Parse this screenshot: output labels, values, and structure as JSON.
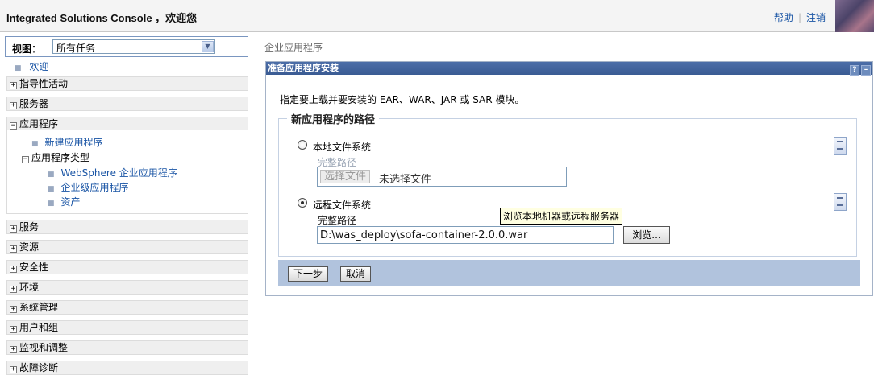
{
  "header": {
    "title": "Integrated Solutions Console ，欢迎您",
    "help": "帮助",
    "separator": "|",
    "logout": "注销"
  },
  "nav": {
    "view_label": "视图：",
    "view_value": "所有任务",
    "welcome": "欢迎",
    "items": [
      {
        "label": "指导性活动",
        "state": "+"
      },
      {
        "label": "服务器",
        "state": "+"
      },
      {
        "label": "应用程序",
        "state": "−"
      },
      {
        "label": "服务",
        "state": "+"
      },
      {
        "label": "资源",
        "state": "+"
      },
      {
        "label": "安全性",
        "state": "+"
      },
      {
        "label": "环境",
        "state": "+"
      },
      {
        "label": "系统管理",
        "state": "+"
      },
      {
        "label": "用户和组",
        "state": "+"
      },
      {
        "label": "监视和调整",
        "state": "+"
      },
      {
        "label": "故障诊断",
        "state": "+"
      }
    ],
    "app_children": {
      "new_app": "新建应用程序",
      "app_types": "应用程序类型",
      "app_types_state": "−",
      "websphere": "WebSphere 企业应用程序",
      "enterprise": "企业级应用程序",
      "assets": "资产"
    }
  },
  "main": {
    "breadcrumb": "企业应用程序",
    "panel_title": "准备应用程序安装",
    "panel_help": "?",
    "panel_min": "–",
    "intro": "指定要上载并要安装的 EAR、WAR、JAR 或 SAR 模块。",
    "legend": "新应用程序的路径",
    "local": {
      "label": "本地文件系统",
      "path_label": "完整路径",
      "choose_button": "选择文件",
      "no_file": "未选择文件"
    },
    "remote": {
      "label": "远程文件系统",
      "path_label": "完整路径",
      "value": "D:\\was_deploy\\sofa-container-2.0.0.war",
      "browse": "浏览...",
      "tooltip": "浏览本地机器或远程服务器"
    },
    "next": "下一步",
    "cancel": "取消"
  }
}
